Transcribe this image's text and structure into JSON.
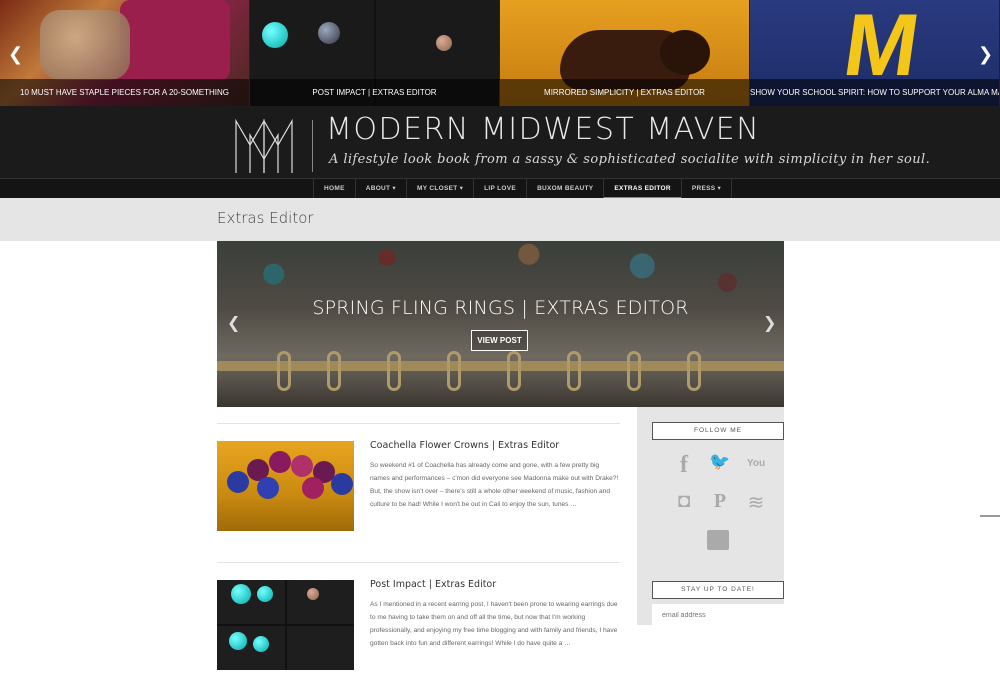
{
  "carousel": {
    "slides": [
      {
        "caption": "10 Must Have Staple Pieces for a 20-Something"
      },
      {
        "caption": "Post Impact | Extras Editor"
      },
      {
        "caption": "Mirrored Simplicity | Extras Editor"
      },
      {
        "caption": "Show Your School Spirit: How to Support Your Alma Mater in S..."
      }
    ],
    "prev_glyph": "❮",
    "next_glyph": "❯"
  },
  "header": {
    "title": "MODERN MIDWEST MAVEN",
    "tagline": "A lifestyle look book from a sassy & sophisticated socialite with simplicity in her soul."
  },
  "nav": {
    "items": [
      {
        "label": "Home"
      },
      {
        "label": "About ▾"
      },
      {
        "label": "My Closet ▾"
      },
      {
        "label": "Lip Love"
      },
      {
        "label": "Buxom Beauty"
      },
      {
        "label": "Extras Editor"
      },
      {
        "label": "Press ▾"
      }
    ],
    "active_color": "#3aa0d0"
  },
  "page": {
    "title": "Extras Editor"
  },
  "hero": {
    "title": "SPRING FLING RINGS | EXTRAS EDITOR",
    "button": "View Post",
    "prev_glyph": "❮",
    "next_glyph": "❯"
  },
  "posts": [
    {
      "title": "Coachella Flower Crowns | Extras Editor",
      "excerpt": "So weekend #1 of Coachella has already come and gone, with a few pretty big names and performances – c'mon did everyone see Madonna make out with Drake?! But, the show isn't over – there's still a whole other weekend of music, fashion and culture to be had! While I won't be out in Cali to enjoy the sun, tunes …"
    },
    {
      "title": "Post Impact | Extras Editor",
      "excerpt": "As I mentioned in a recent earring post, I haven't been prone to wearing earrings due to me having to take them on and off all the time, but now that I'm working professionally, and enjoying my free time blogging and with family and friends, I have gotten back into fun and different earrings! While I do have quite a …"
    }
  ],
  "sidebar": {
    "follow_title": "Follow Me",
    "social_icons": [
      "facebook-icon",
      "twitter-icon",
      "youtube-icon",
      "instagram-icon",
      "pinterest-icon",
      "rss-icon"
    ],
    "social_glyphs": [
      "f",
      "🐦",
      "You",
      "◘",
      "P",
      "≋"
    ],
    "newsletter_title": "Stay Up to Date!",
    "email_placeholder": "email address"
  }
}
